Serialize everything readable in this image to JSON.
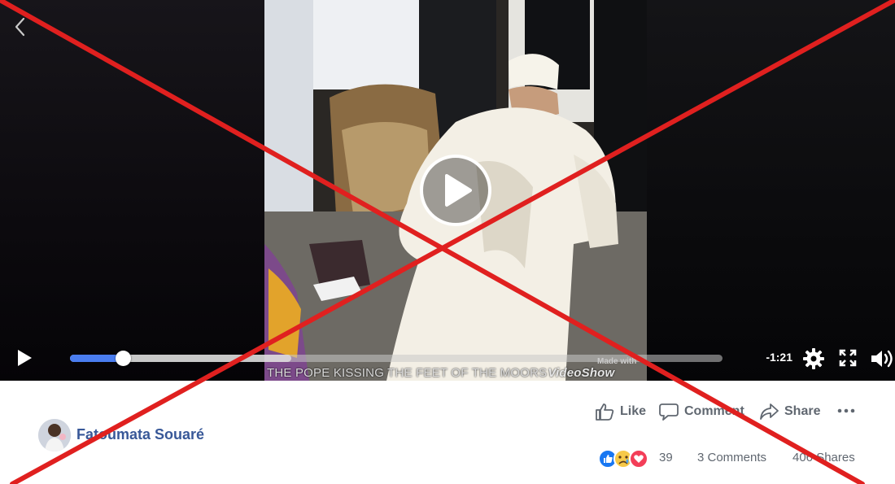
{
  "video": {
    "time_remaining": "-1:21",
    "progress_fraction": 0.081,
    "buffered_fraction": 0.339,
    "caption": "THE POPE KISSING THE FEET OF THE MOORS",
    "watermark_prefix": "Made with",
    "watermark_brand": "VideoShow"
  },
  "actions": {
    "like_label": "Like",
    "comment_label": "Comment",
    "share_label": "Share"
  },
  "post": {
    "author": "Fatoumata Souaré",
    "reaction_count": "39",
    "comments_text": "3 Comments",
    "shares_text": "406 Shares",
    "reactions": [
      "like",
      "sad",
      "love"
    ]
  },
  "overlay": {
    "cross_color": "#e0201f"
  },
  "colors": {
    "progress": "#4a7df0",
    "link": "#385898",
    "meta": "#606770"
  }
}
